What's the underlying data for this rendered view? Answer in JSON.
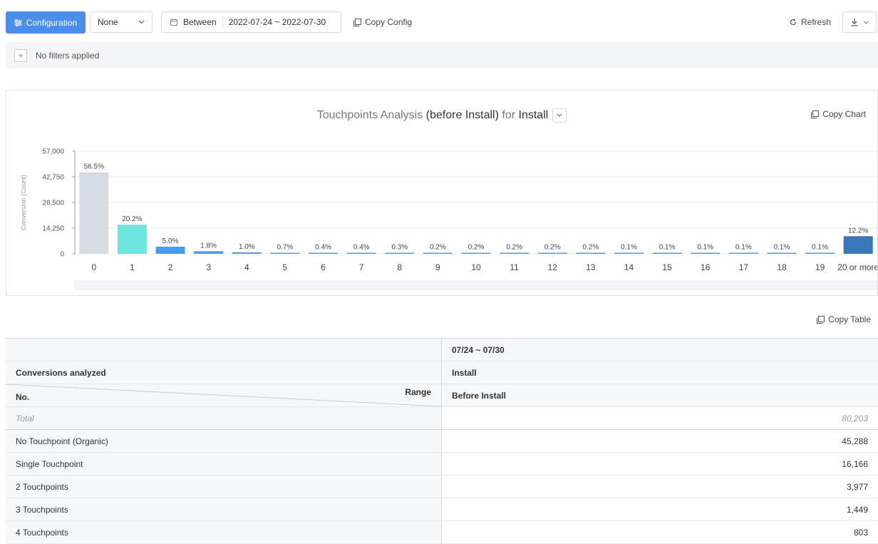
{
  "toolbar": {
    "config_label": "Configuration",
    "group_select": "None",
    "date_label": "Between",
    "date_value": "2022-07-24 ~ 2022-07-30",
    "copy_config": "Copy Config",
    "refresh": "Refresh"
  },
  "filters": {
    "text": "No filters applied",
    "add": "+"
  },
  "chart": {
    "copy_label": "Copy Chart"
  },
  "chart_data": {
    "type": "bar",
    "title": "Touchpoints Analysis (before Install) for Install",
    "title_parts": {
      "a": "Touchpoints Analysis ",
      "b": "(before Install)",
      "c": " for ",
      "d": "Install"
    },
    "ylabel": "Conversion (Count)",
    "ylim": [
      0,
      57000
    ],
    "yticks": [
      "57,000",
      "42,750",
      "28,500",
      "14,250",
      "0"
    ],
    "yticks_values": [
      57000,
      42750,
      28500,
      14250,
      0
    ],
    "categories": [
      "0",
      "1",
      "2",
      "3",
      "4",
      "5",
      "6",
      "7",
      "8",
      "9",
      "10",
      "11",
      "12",
      "13",
      "14",
      "15",
      "16",
      "17",
      "18",
      "19",
      "20 or more"
    ],
    "values": [
      45288,
      16166,
      3977,
      1449,
      803,
      560,
      320,
      320,
      240,
      160,
      160,
      160,
      160,
      160,
      80,
      80,
      80,
      80,
      80,
      80,
      9785
    ],
    "labels": [
      "56.5%",
      "20.2%",
      "5.0%",
      "1.8%",
      "1.0%",
      "0.7%",
      "0.4%",
      "0.4%",
      "0.3%",
      "0.2%",
      "0.2%",
      "0.2%",
      "0.2%",
      "0.2%",
      "0.1%",
      "0.1%",
      "0.1%",
      "0.1%",
      "0.1%",
      "0.1%",
      "12.2%"
    ],
    "colors": [
      "#d5dce3",
      "#6ce5de",
      "#4a9bf0",
      "#4a9bf0",
      "#4a9bf0",
      "#4a9bf0",
      "#4a9bf0",
      "#4a9bf0",
      "#4a9bf0",
      "#4a9bf0",
      "#4a9bf0",
      "#4a9bf0",
      "#4a9bf0",
      "#4a9bf0",
      "#4a9bf0",
      "#4a9bf0",
      "#4a9bf0",
      "#4a9bf0",
      "#4a9bf0",
      "#4a9bf0",
      "#3a76b8"
    ],
    "grid": true
  },
  "table": {
    "copy_label": "Copy Table",
    "period": "07/24 ~ 07/30",
    "conv_label": "Conversions analyzed",
    "conv_value": "Install",
    "no_label": "No.",
    "range_label": "Range",
    "range_value": "Before Install",
    "total_label": "Total",
    "total_value": "80,203",
    "rows": [
      {
        "label": "No Touchpoint (Organic)",
        "value": "45,288"
      },
      {
        "label": "Single Touchpoint",
        "value": "16,166"
      },
      {
        "label": "2 Touchpoints",
        "value": "3,977"
      },
      {
        "label": "3 Touchpoints",
        "value": "1,449"
      },
      {
        "label": "4 Touchpoints",
        "value": "803"
      }
    ]
  },
  "colors": {
    "accent": "#4a8fe7"
  }
}
